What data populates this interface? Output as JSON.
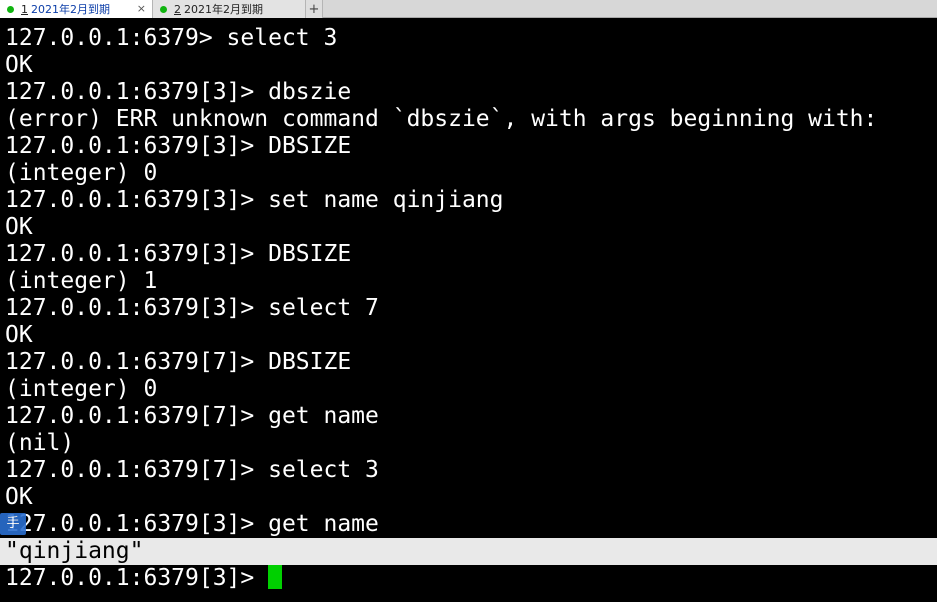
{
  "tabs": [
    {
      "num": "1",
      "label": "2021年2月到期",
      "active": true,
      "close": "×"
    },
    {
      "num": "2",
      "label": "2021年2月到期",
      "active": false
    }
  ],
  "tab_add": "+",
  "terminal": {
    "lines": [
      "127.0.0.1:6379> select 3",
      "OK",
      "127.0.0.1:6379[3]> dbszie",
      "(error) ERR unknown command `dbszie`, with args beginning with:",
      "127.0.0.1:6379[3]> DBSIZE",
      "(integer) 0",
      "127.0.0.1:6379[3]> set name qinjiang",
      "OK",
      "127.0.0.1:6379[3]> DBSIZE",
      "(integer) 1",
      "127.0.0.1:6379[3]> select 7",
      "OK",
      "127.0.0.1:6379[7]> DBSIZE",
      "(integer) 0",
      "127.0.0.1:6379[7]> get name",
      "(nil)",
      "127.0.0.1:6379[7]> select 3",
      "OK",
      "127.0.0.1:6379[3]> get name",
      "\"qinjiang\"",
      "127.0.0.1:6379[3]> "
    ],
    "highlighted_line": 19
  },
  "ime_icon": "手",
  "colors": {
    "background": "#000000",
    "text": "#ffffff",
    "cursor": "#00d000",
    "highlight": "#e9e9e9",
    "tab_dot": "#10b410"
  }
}
